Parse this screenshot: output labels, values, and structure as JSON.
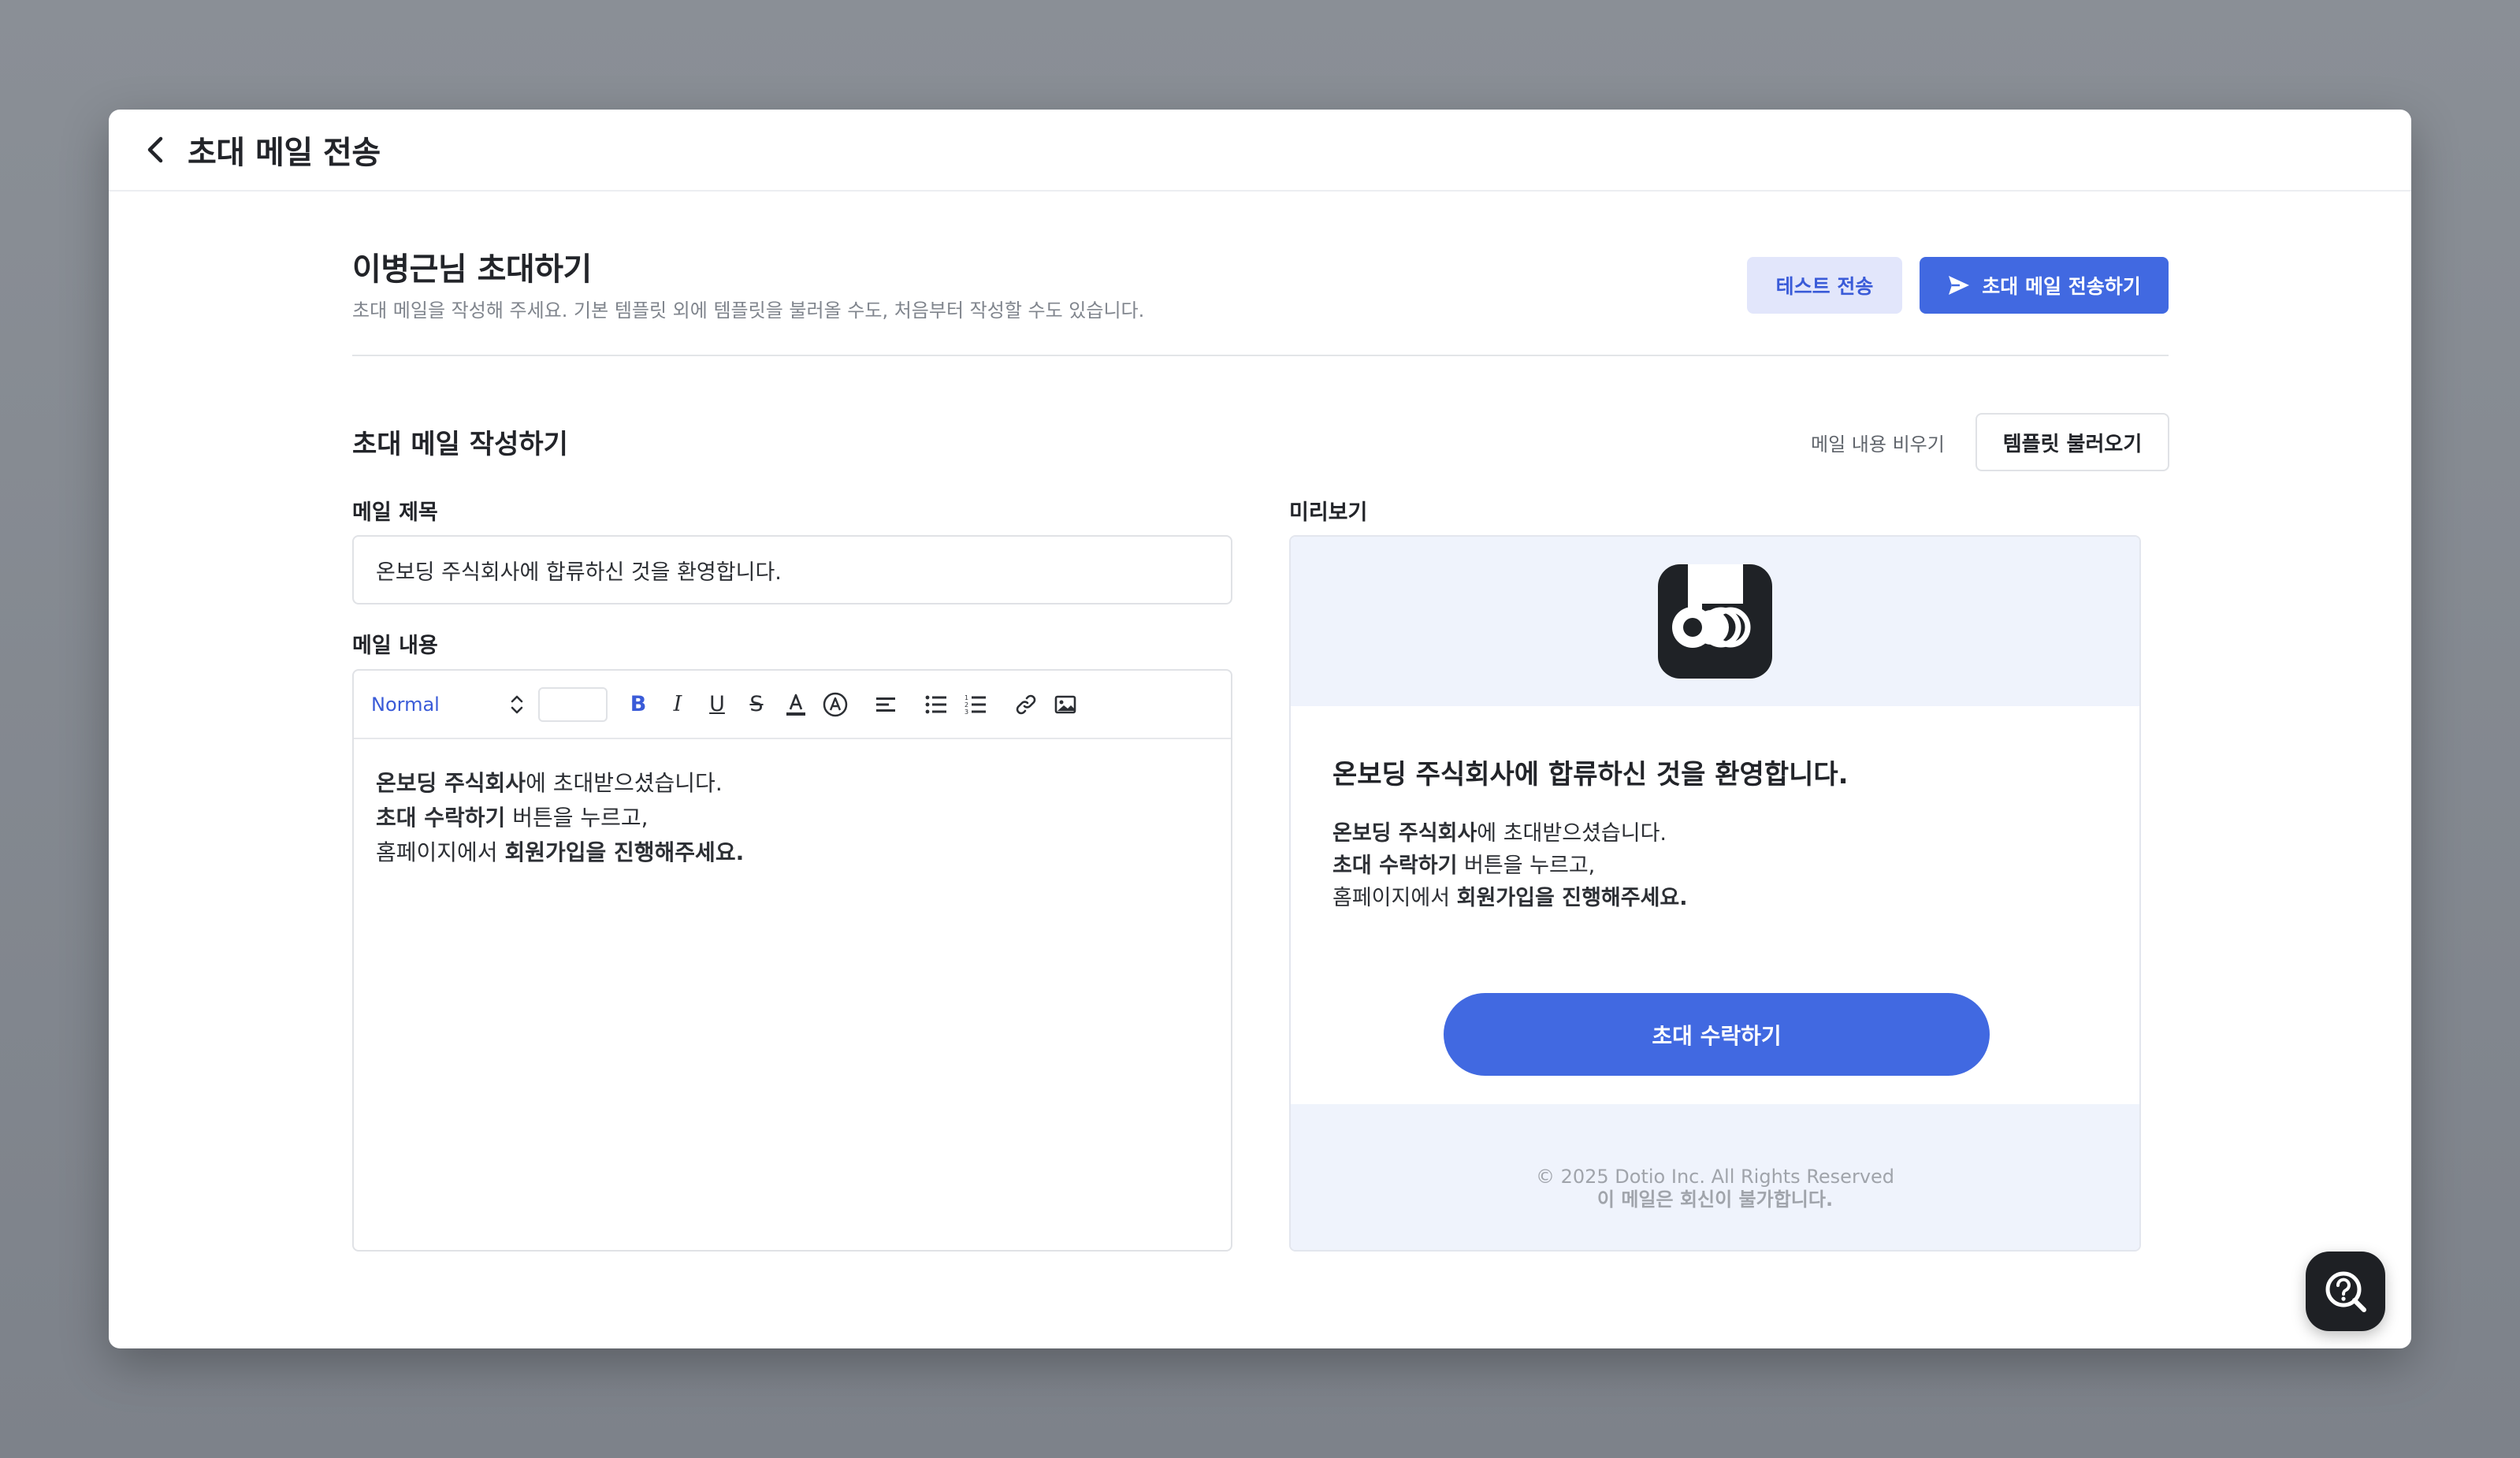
{
  "header": {
    "title": "초대 메일 전송"
  },
  "invite": {
    "title": "이병근님 초대하기",
    "description": "초대 메일을 작성해 주세요. 기본 템플릿 외에 템플릿을 불러올 수도, 처음부터 작성할 수도 있습니다.",
    "test_send_label": "테스트 전송",
    "send_label": "초대 메일 전송하기"
  },
  "compose": {
    "section_title": "초대 메일 작성하기",
    "clear_label": "메일 내용 비우기",
    "load_template_label": "템플릿 불러오기",
    "subject_label": "메일 제목",
    "subject_value": "온보딩 주식회사에 합류하신 것을 환영합니다.",
    "body_label": "메일 내용",
    "format_value": "Normal",
    "body": {
      "line1_bold": "온보딩 주식회사",
      "line1_rest": "에 초대받으셨습니다.",
      "line2_bold": "초대 수락하기",
      "line2_rest": " 버튼을 누르고,",
      "line3_start": "홈페이지에서 ",
      "line3_bold": "회원가입을 진행해주세요."
    }
  },
  "preview": {
    "label": "미리보기",
    "title": "온보딩 주식회사에 합류하신 것을 환영합니다.",
    "line1_bold": "온보딩 주식회사",
    "line1_rest": "에 초대받으셨습니다.",
    "line2_bold": "초대 수락하기",
    "line2_rest": " 버튼을 누르고,",
    "line3_start": "홈페이지에서 ",
    "line3_bold": "회원가입을 진행해주세요.",
    "accept_button": "초대 수락하기",
    "copyright": "© 2025 Dotio Inc. All Rights Reserved",
    "no_reply": "이 메일은 회신이 불가합니다."
  },
  "colors": {
    "accent": "#4169e1",
    "accent_soft": "#e2e6fb",
    "preview_bg": "#eff3fc"
  }
}
